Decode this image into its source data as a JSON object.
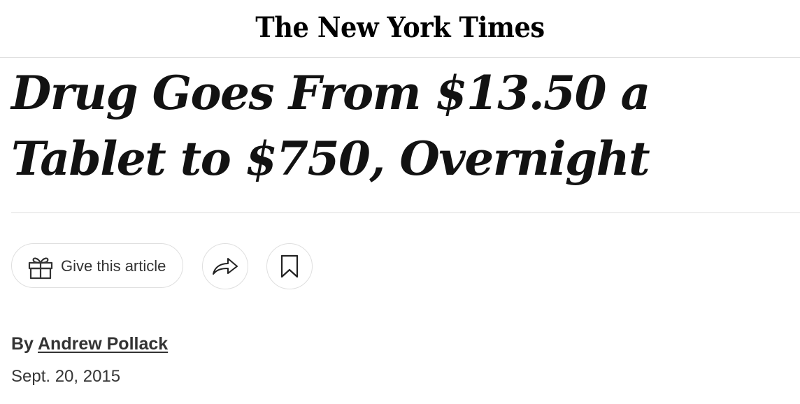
{
  "masthead": {
    "logo_text": "The New York Times"
  },
  "article": {
    "headline": "Drug Goes From $13.50 a Tablet to $750, Overnight",
    "byline_prefix": "By",
    "author": "Andrew Pollack",
    "date": "Sept. 20, 2015"
  },
  "actions": {
    "gift_label": "Give this article",
    "gift_icon": "gift-icon",
    "share_icon": "share-icon",
    "save_icon": "bookmark-icon"
  }
}
